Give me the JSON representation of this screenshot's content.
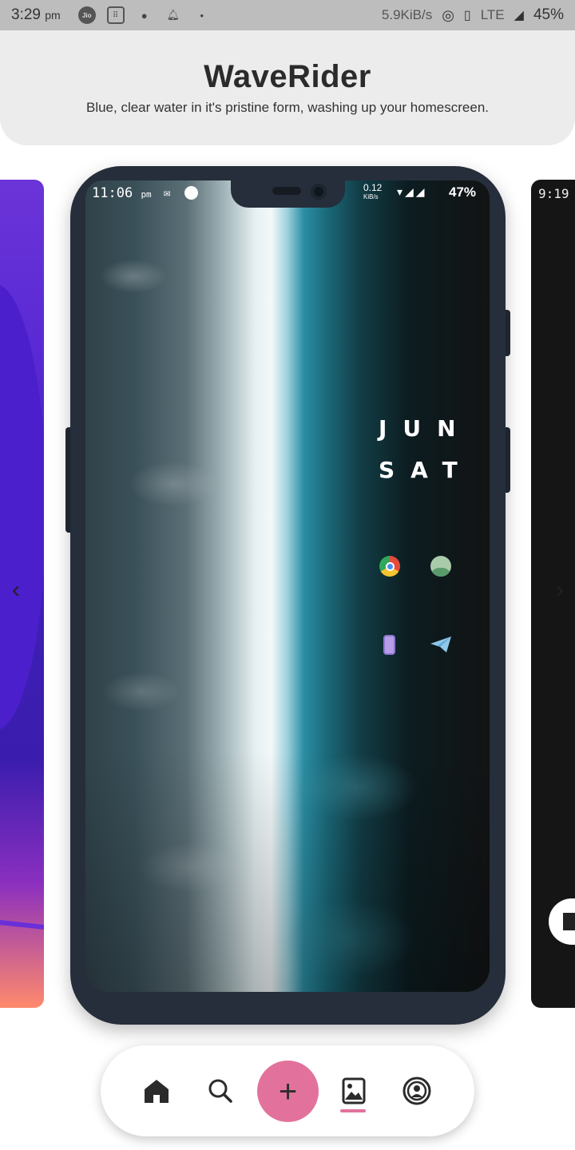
{
  "status_bar": {
    "time": "3:29",
    "ampm": "pm",
    "jio_label": "Jio",
    "speed": "5.9KiB/s",
    "network": "LTE",
    "battery": "45%",
    "icons": [
      "jio-icon",
      "grid-icon",
      "reddit-icon",
      "bell-icon",
      "dot-icon",
      "location-icon",
      "vibrate-icon",
      "signal-icon"
    ]
  },
  "header": {
    "title": "WaveRider",
    "subtitle": "Blue, clear water in it's pristine form, washing up your homescreen."
  },
  "preview": {
    "status": {
      "time": "11:06",
      "ampm": "pm",
      "speed": "0.12",
      "speed_unit": "KiB/s",
      "battery": "47%"
    },
    "widget": {
      "month": "JUN",
      "day": "SAT"
    },
    "apps": [
      "chrome-icon",
      "contacts-icon",
      "phone-icon",
      "telegram-icon"
    ]
  },
  "side_previews": {
    "right_time": "9:19"
  },
  "carousel": {
    "prev_arrow": "‹",
    "next_arrow": "›"
  },
  "bottom_nav": {
    "add_label": "+",
    "items": [
      "home-icon",
      "search-icon",
      "add-icon",
      "wallpapers-icon",
      "profile-icon"
    ],
    "active_item": "wallpapers-icon",
    "accent": "#e2729b"
  },
  "colors": {
    "status_bar_bg": "#bdbdbd",
    "header_bg": "#ececec",
    "phone_frame": "#262e3b",
    "accent": "#e2729b"
  }
}
